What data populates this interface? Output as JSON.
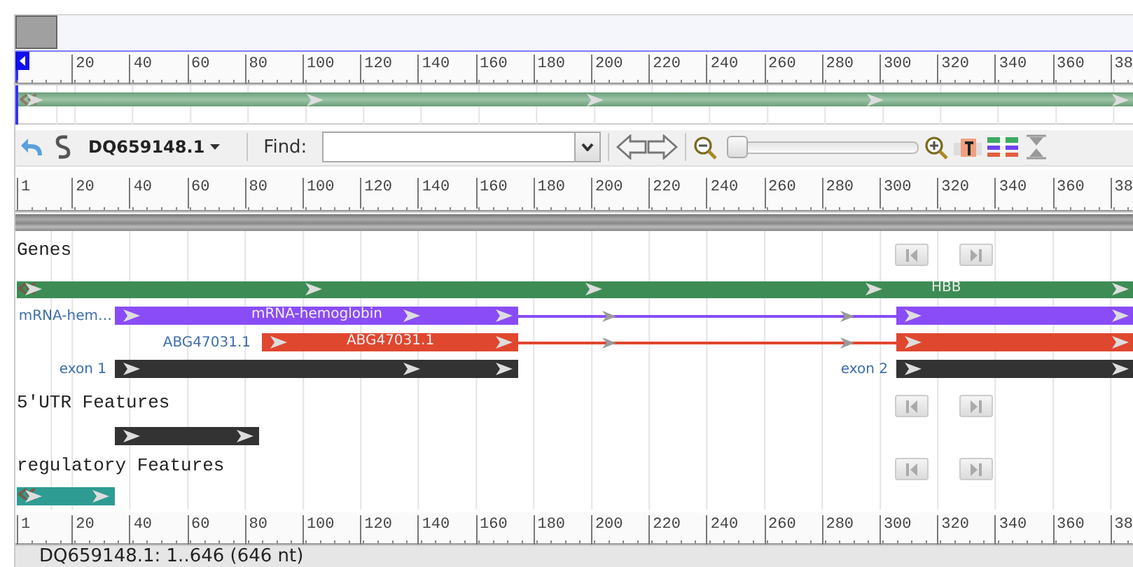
{
  "overview": {
    "ruler": {
      "labels": [
        "20",
        "40",
        "60",
        "80",
        "100",
        "120",
        "140",
        "160",
        "180",
        "200",
        "220",
        "240",
        "260",
        "280",
        "300",
        "320",
        "340",
        "360",
        "38"
      ]
    }
  },
  "toolbar": {
    "sequence": "DQ659148.1",
    "find_label": "Find:",
    "zoom": {
      "level": 0
    }
  },
  "ruler": {
    "labels": [
      "1",
      "20",
      "40",
      "60",
      "80",
      "100",
      "120",
      "140",
      "160",
      "180",
      "200",
      "220",
      "240",
      "260",
      "280",
      "300",
      "320",
      "340",
      "360",
      "38"
    ]
  },
  "tracks": [
    {
      "title": "Genes",
      "features": [
        {
          "label": "HBB",
          "color": "#3d8c55"
        },
        {
          "side_label": "mRNA-hem…",
          "label": "mRNA-hemoglobin",
          "color": "#8a4cf6"
        },
        {
          "side_label": "ABG47031.1",
          "label": "ABG47031.1",
          "color": "#e0472f"
        },
        {
          "side_label": "exon 1",
          "color": "#333333"
        },
        {
          "side_label": "exon 2",
          "color": "#333333"
        }
      ]
    },
    {
      "title": "5'UTR Features",
      "features": [
        {
          "color": "#333333"
        }
      ]
    },
    {
      "title": "regulatory Features",
      "features": [
        {
          "color": "#2e9c92"
        }
      ]
    }
  ],
  "bottom_ruler": {
    "labels": [
      "1",
      "20",
      "40",
      "60",
      "80",
      "100",
      "120",
      "140",
      "160",
      "180",
      "200",
      "220",
      "240",
      "260",
      "280",
      "300",
      "320",
      "340",
      "360",
      "38"
    ]
  },
  "status": "DQ659148.1: 1..646 (646 nt)"
}
